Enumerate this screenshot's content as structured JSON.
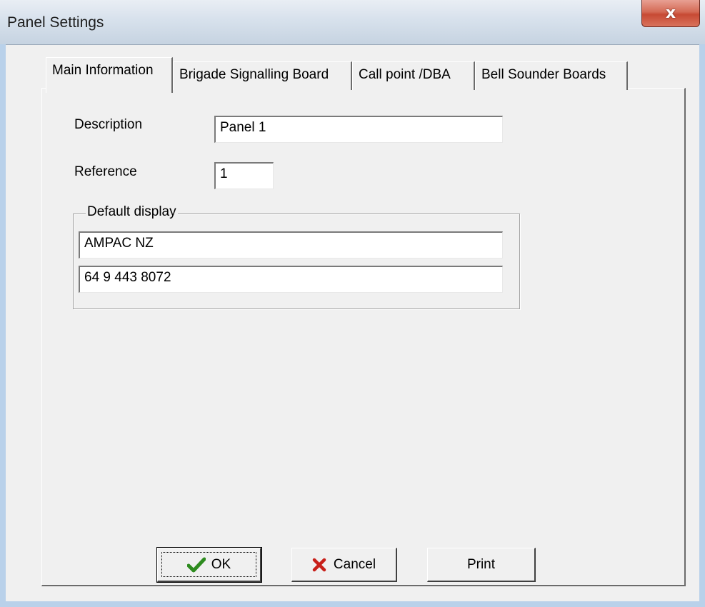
{
  "window": {
    "title": "Panel Settings",
    "close_glyph": "x"
  },
  "tabs": [
    {
      "label": "Main Information",
      "active": true
    },
    {
      "label": "Brigade Signalling Board",
      "active": false
    },
    {
      "label": "Call point /DBA",
      "active": false
    },
    {
      "label": "Bell Sounder Boards",
      "active": false
    }
  ],
  "main": {
    "description_label": "Description",
    "description_value": "Panel 1",
    "reference_label": "Reference",
    "reference_value": "1",
    "default_display": {
      "legend": "Default display",
      "line1": "AMPAC NZ",
      "line2": "64 9 443 8072"
    }
  },
  "buttons": {
    "ok_label": "OK",
    "cancel_label": "Cancel",
    "print_label": "Print"
  },
  "colors": {
    "check_green": "#2e8b1f",
    "cancel_red": "#c8201a",
    "close_red": "#c74a34"
  },
  "icons": {
    "ok": "checkmark-icon",
    "cancel": "x-icon",
    "close": "close-icon"
  }
}
